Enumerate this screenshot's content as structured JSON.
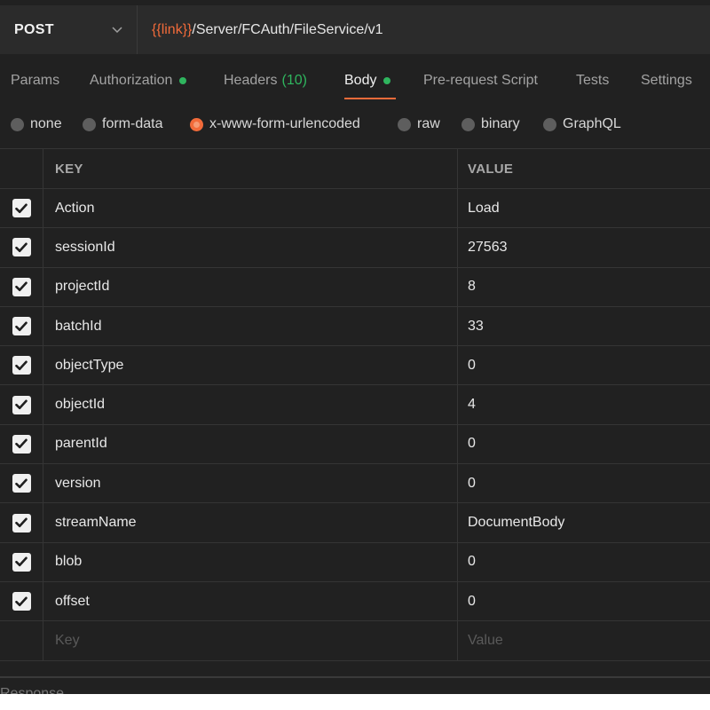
{
  "request": {
    "method": "POST",
    "url_variable": "{{link}}",
    "url_path": "/Server/FCAuth/FileService/v1"
  },
  "tabs": [
    {
      "label": "Params"
    },
    {
      "label": "Authorization"
    },
    {
      "label": "Headers",
      "count": "(10)"
    },
    {
      "label": "Body"
    },
    {
      "label": "Pre-request Script"
    },
    {
      "label": "Tests"
    },
    {
      "label": "Settings"
    }
  ],
  "active_tab": "Body",
  "body_types": [
    {
      "label": "none",
      "checked": false
    },
    {
      "label": "form-data",
      "checked": false
    },
    {
      "label": "x-www-form-urlencoded",
      "checked": true
    },
    {
      "label": "raw",
      "checked": false
    },
    {
      "label": "binary",
      "checked": false
    },
    {
      "label": "GraphQL",
      "checked": false
    }
  ],
  "table": {
    "headers": {
      "key": "KEY",
      "value": "VALUE"
    },
    "rows": [
      {
        "key": "Action",
        "value": "Load",
        "enabled": true
      },
      {
        "key": "sessionId",
        "value": "27563",
        "enabled": true
      },
      {
        "key": "projectId",
        "value": "8",
        "enabled": true
      },
      {
        "key": "batchId",
        "value": "33",
        "enabled": true
      },
      {
        "key": "objectType",
        "value": "0",
        "enabled": true
      },
      {
        "key": "objectId",
        "value": "4",
        "enabled": true
      },
      {
        "key": "parentId",
        "value": "0",
        "enabled": true
      },
      {
        "key": "version",
        "value": "0",
        "enabled": true
      },
      {
        "key": "streamName",
        "value": "DocumentBody",
        "enabled": true
      },
      {
        "key": "blob",
        "value": "0",
        "enabled": true
      },
      {
        "key": "offset",
        "value": "0",
        "enabled": true
      }
    ],
    "placeholder": {
      "key": "Key",
      "value": "Value"
    }
  },
  "response_label": "Response",
  "colors": {
    "accent": "#f26b3a",
    "status_green": "#2fb55e",
    "background": "#212121"
  }
}
